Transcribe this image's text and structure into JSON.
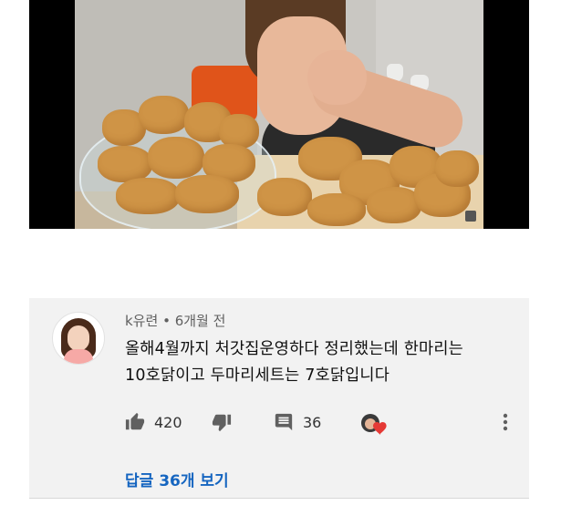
{
  "video": {
    "description": ""
  },
  "comment": {
    "author": "k유련",
    "separator": " • ",
    "time": "6개월 전",
    "text_lines": [
      "올해4월까지 처갓집운영하다 정리했는데 한마리는",
      "10호닭이고 두마리세트는 7호닭입니다"
    ],
    "likes": "420",
    "replies_count": "36",
    "reply_link": "답글 36개 보기"
  },
  "icons": {
    "like": "thumb-up-icon",
    "dislike": "thumb-down-icon",
    "reply": "comment-icon",
    "heart": "creator-heart-icon",
    "more": "more-vertical-icon"
  },
  "colors": {
    "link": "#1565c0",
    "heart": "#e53935",
    "card_bg": "#f2f2f2"
  }
}
